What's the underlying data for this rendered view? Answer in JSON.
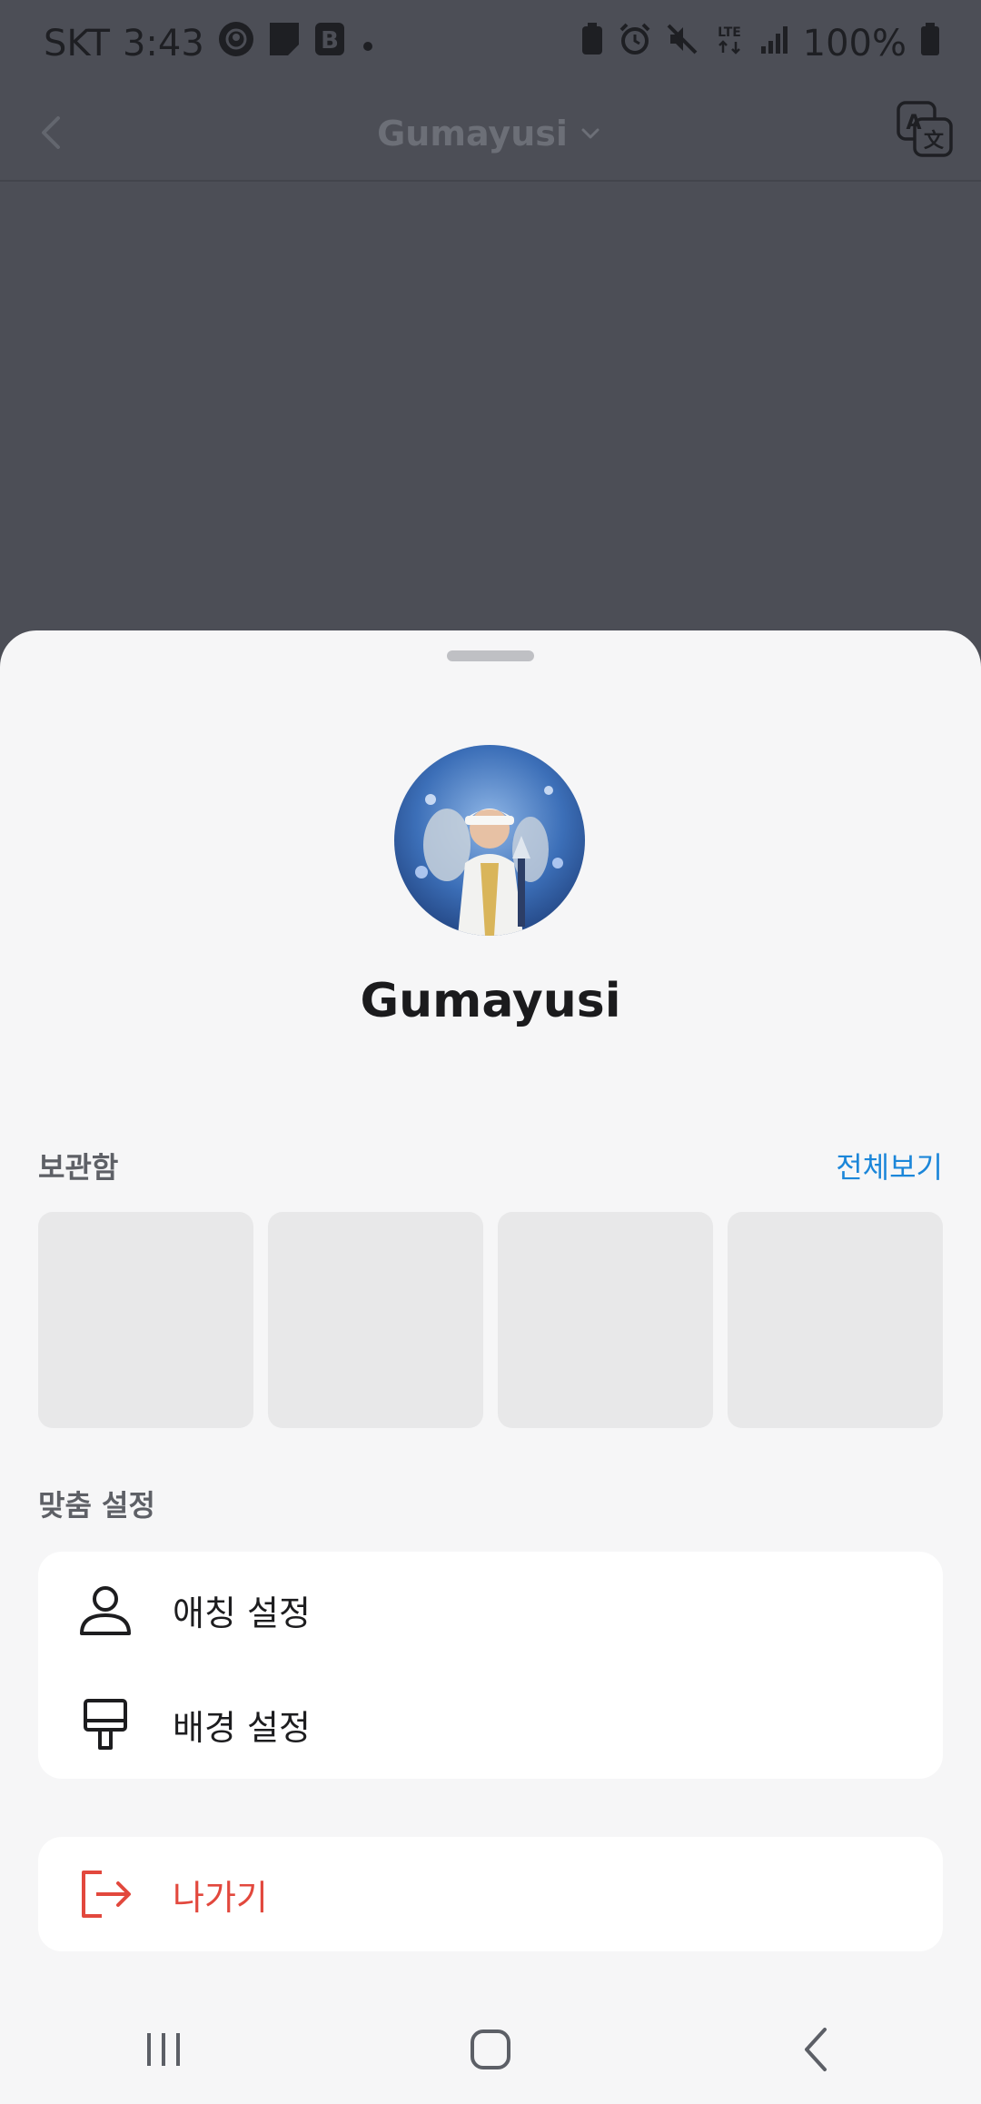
{
  "status_bar": {
    "carrier": "SKT",
    "time": "3:43",
    "network": "LTE",
    "battery": "100%"
  },
  "app_bar": {
    "title": "Gumayusi"
  },
  "profile": {
    "name": "Gumayusi"
  },
  "archive": {
    "label": "보관함",
    "see_all": "전체보기"
  },
  "custom_settings": {
    "label": "맞춤 설정",
    "items": [
      {
        "label": "애칭 설정",
        "icon": "person-icon"
      },
      {
        "label": "배경 설정",
        "icon": "paint-brush-icon"
      }
    ]
  },
  "exit": {
    "label": "나가기",
    "icon": "exit-icon",
    "color": "#e2483d"
  },
  "colors": {
    "accent": "#1b86d9",
    "danger": "#e2483d",
    "overlay": "#4c4e56",
    "sheet": "#f6f6f7"
  }
}
